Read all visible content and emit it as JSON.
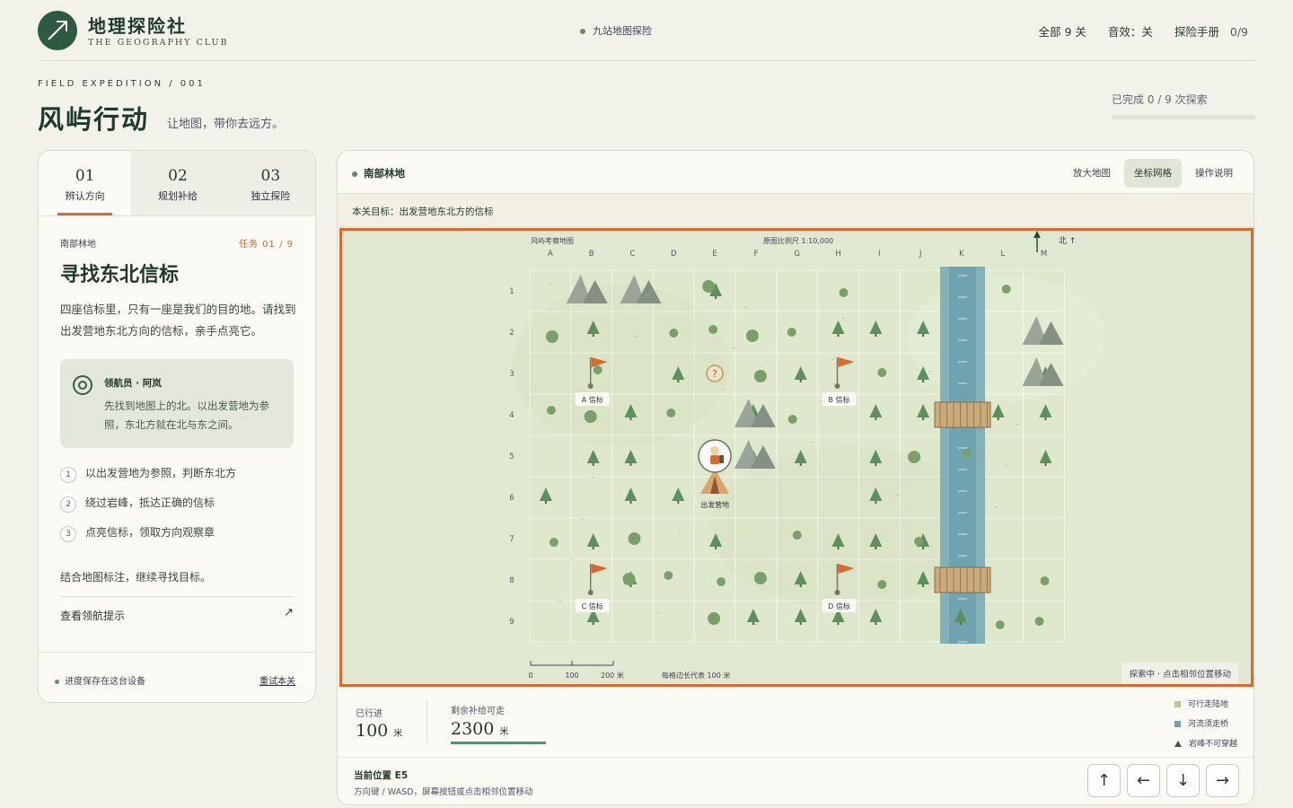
{
  "header": {
    "brand": "地理探险社",
    "brand_sub": "THE GEOGRAPHY CLUB",
    "center": "九站地图探险",
    "levels": "全部 9 关",
    "sound": "音效：关",
    "handbook": "探险手册",
    "handbook_count": "0/9"
  },
  "hero": {
    "eyebrow": "FIELD EXPEDITION / 001",
    "title": "风屿行动",
    "tagline": "让地图，带你去远方。",
    "progress_label": "已完成 0 / 9 次探索",
    "progress": 0
  },
  "tabs": [
    {
      "num": "01",
      "label": "辨认方向"
    },
    {
      "num": "02",
      "label": "规划补给"
    },
    {
      "num": "03",
      "label": "独立探险"
    }
  ],
  "task": {
    "area": "南部林地",
    "counter": "任务 01 / 9",
    "title": "寻找东北信标",
    "desc": "四座信标里，只有一座是我们的目的地。请找到出发营地东北方向的信标，亲手点亮它。",
    "guide_name": "领航员 · 阿岚",
    "guide_text": "先找到地图上的北。以出发营地为参照，东北方就在北与东之间。",
    "steps": [
      {
        "n": "1",
        "text": "以出发营地为参照，判断东北方"
      },
      {
        "n": "2",
        "text": "绕过岩峰，抵达正确的信标"
      },
      {
        "n": "3",
        "text": "点亮信标，领取方向观察章"
      }
    ],
    "hint": "结合地图标注，继续寻找目标。",
    "link": "查看领航提示",
    "link_arrow": "↗",
    "save": "进度保存在这台设备",
    "reset": "重试本关"
  },
  "map_panel": {
    "area": "南部林地",
    "buttons": [
      "放大地图",
      "坐标网格",
      "操作说明"
    ],
    "goal": "本关目标：出发营地东北方的信标",
    "map_title": "风屿考察地图",
    "scale_text": "原图比例尺 1:10,000",
    "north": "北 ↑",
    "cols": [
      "A",
      "B",
      "C",
      "D",
      "E",
      "F",
      "G",
      "H",
      "I",
      "J",
      "K",
      "L",
      "M"
    ],
    "rows": [
      "1",
      "2",
      "3",
      "4",
      "5",
      "6",
      "7",
      "8",
      "9"
    ],
    "beacons": [
      {
        "label": "A 信标",
        "col": 1,
        "row": 3
      },
      {
        "label": "B 信标",
        "col": 7,
        "row": 3
      },
      {
        "label": "C 信标",
        "col": 1,
        "row": 8
      },
      {
        "label": "D 信标",
        "col": 7,
        "row": 8
      }
    ],
    "camp_label": "出发营地",
    "mystery": "?",
    "scale_ticks": [
      "0",
      "100",
      "200 米"
    ],
    "cell_note": "每格边长代表 100 米",
    "status": "探索中 · 点击相邻位置移动"
  },
  "stats": {
    "walked_label": "已行进",
    "walked_value": "100",
    "walked_unit": "米",
    "supply_label": "剩余补给可走",
    "supply_value": "2300",
    "supply_unit": "米"
  },
  "legend": [
    {
      "label": "可行走陆地",
      "color": "#b9c79a"
    },
    {
      "label": "河流须走桥",
      "color": "#6fa3b0"
    },
    {
      "label": "岩峰不可穿越",
      "icon": "mountain-icon"
    }
  ],
  "position": {
    "current": "当前位置 E5",
    "help": "方向键 / WASD，屏幕按钮或点击相邻位置移动"
  },
  "controls": [
    "↑",
    "←",
    "↓",
    "→"
  ],
  "colors": {
    "accent": "#d9692f",
    "brand": "#2c5a42",
    "river": "#6fa3b0"
  }
}
